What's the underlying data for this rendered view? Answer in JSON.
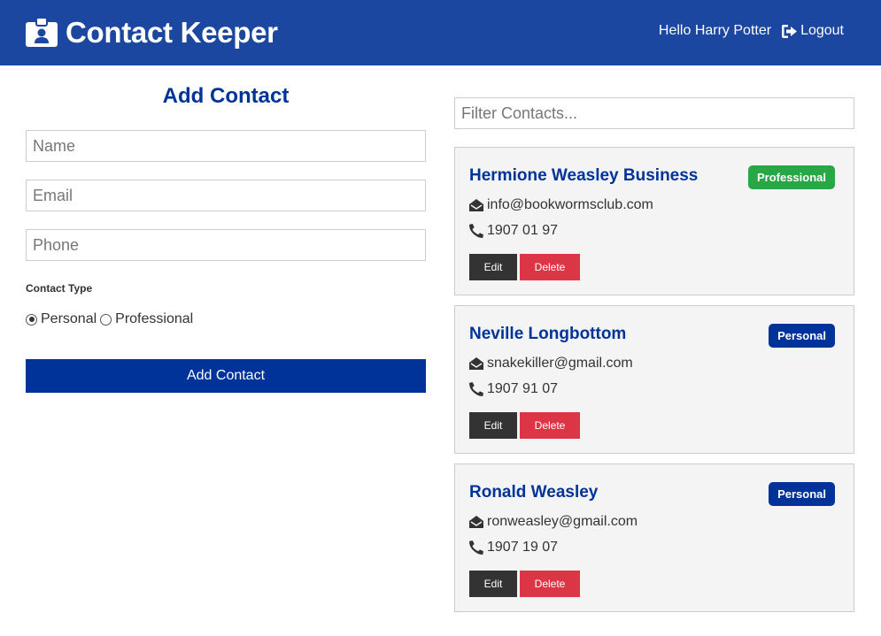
{
  "navbar": {
    "title": "Contact Keeper",
    "brand_icon": "id-badge-icon",
    "greeting": "Hello Harry Potter",
    "logout_label": "Logout",
    "logout_icon": "sign-out-icon",
    "background_color": "#1b47a0"
  },
  "form": {
    "title": "Add Contact",
    "name_placeholder": "Name",
    "email_placeholder": "Email",
    "phone_placeholder": "Phone",
    "contact_type_label": "Contact Type",
    "options": [
      {
        "label": "Personal",
        "checked": true
      },
      {
        "label": "Professional",
        "checked": false
      }
    ],
    "submit_label": "Add Contact"
  },
  "filter": {
    "placeholder": "Filter Contacts..."
  },
  "contacts": [
    {
      "name": "Hermione Weasley Business",
      "type": "Professional",
      "email": "info@bookwormsclub.com",
      "phone": "1907 01 97"
    },
    {
      "name": "Neville Longbottom",
      "type": "Personal",
      "email": "snakekiller@gmail.com",
      "phone": "1907 91 07"
    },
    {
      "name": "Ronald Weasley",
      "type": "Personal",
      "email": "ronweasley@gmail.com",
      "phone": "1907 19 07"
    }
  ],
  "buttons": {
    "edit_label": "Edit",
    "delete_label": "Delete"
  },
  "colors": {
    "primary": "#003399",
    "professional": "#28a745",
    "dark": "#333333",
    "danger": "#dc3545",
    "card_bg": "#f4f4f4"
  }
}
